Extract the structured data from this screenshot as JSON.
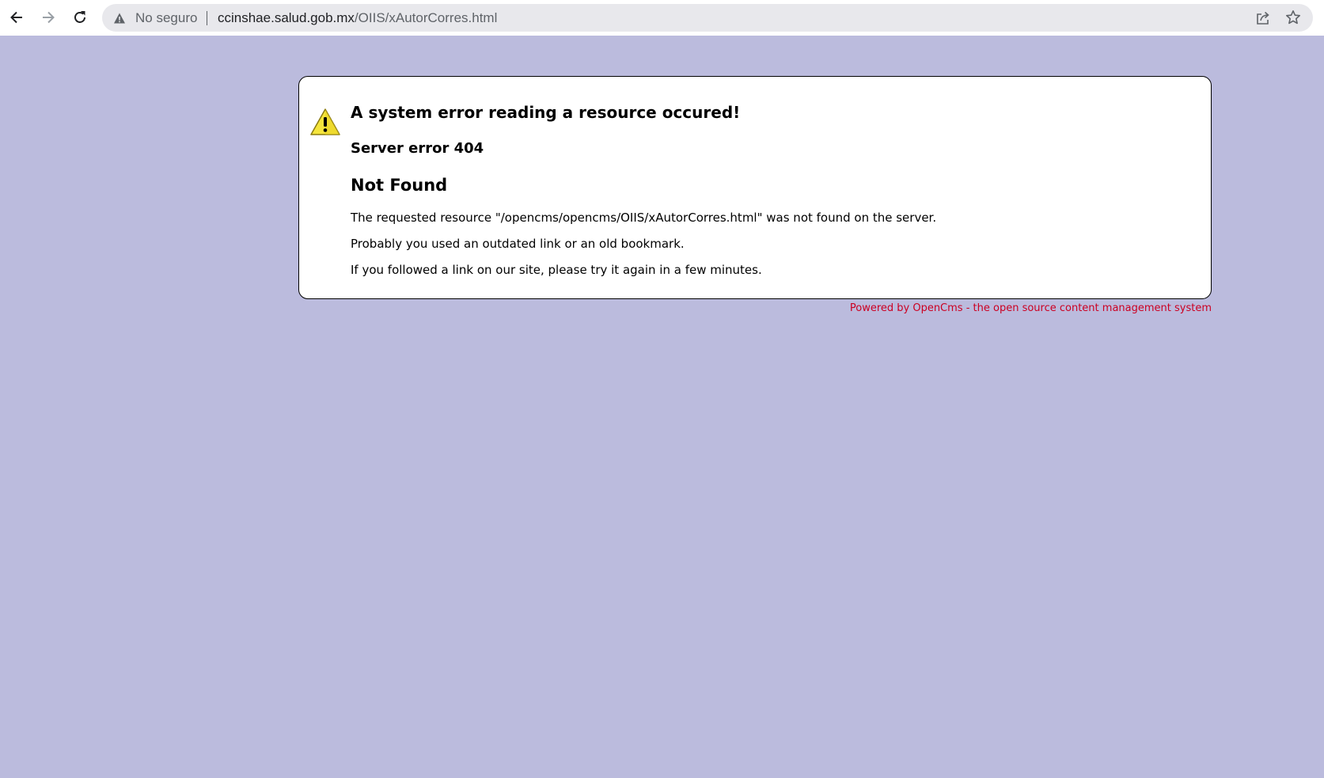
{
  "browser": {
    "security_label": "No seguro",
    "url_host": "ccinshae.salud.gob.mx",
    "url_path": "/OIIS/xAutorCorres.html"
  },
  "error": {
    "title": "A system error reading a resource occured!",
    "code": "Server error 404",
    "reason": "Not Found",
    "line1": "The requested resource \"/opencms/opencms/OIIS/xAutorCorres.html\" was not found on the server.",
    "line2": "Probably you used an outdated link or an old bookmark.",
    "line3": "If you followed a link on our site, please try it again in a few minutes."
  },
  "footer": {
    "text": "Powered by OpenCms - the open source content management system"
  },
  "colors": {
    "background": "#bbbbdd",
    "footer_text": "#cc0022",
    "warning_yellow": "#f5e53c"
  }
}
